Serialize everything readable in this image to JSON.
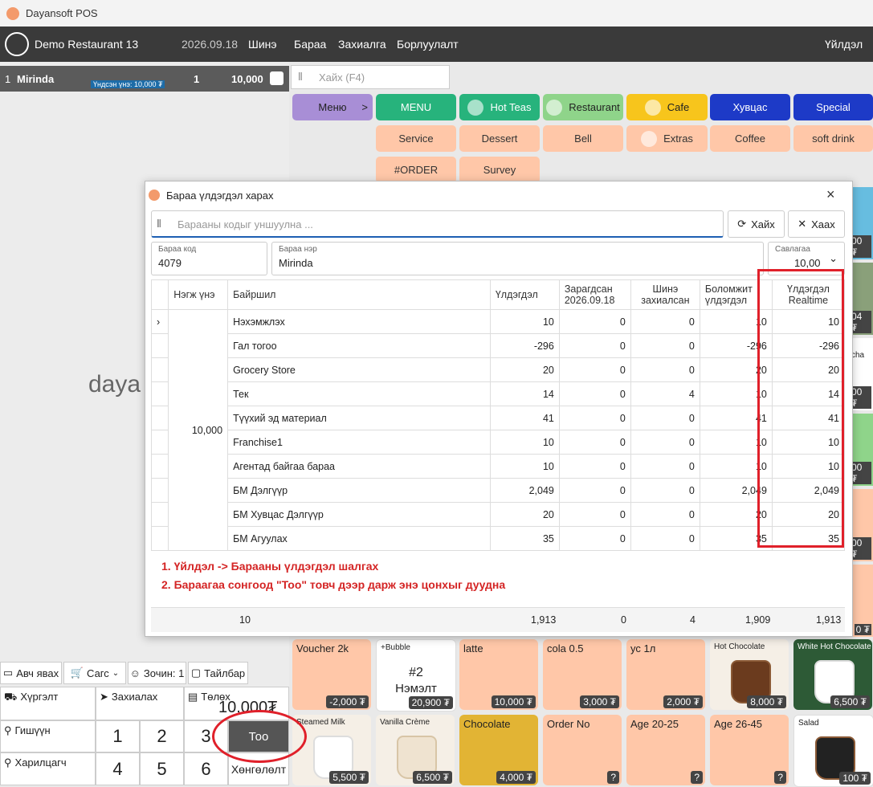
{
  "app": {
    "title": "Dayansoft POS"
  },
  "topbar": {
    "restaurant": "Demo Restaurant 13",
    "date": "2026.09.18",
    "menu": [
      "Шинэ",
      "Бараа",
      "Захиалга",
      "Борлуулалт"
    ],
    "right": "Үйлдэл"
  },
  "order": {
    "line": "1",
    "item": "Mirinda",
    "base_price": "Үндсэн үнэ: 10,000 ₮",
    "qty": "1",
    "total": "10,000"
  },
  "search": {
    "placeholder": "Хайх (F4)"
  },
  "categories": {
    "row1": [
      "Меню",
      ">",
      "MENU",
      "Hot Teas",
      "Restaurant",
      "Cafe",
      "Хувцас",
      "Special"
    ],
    "row2": [
      "Service",
      "Dessert",
      "Bell",
      "Extras",
      "Coffee",
      "soft drink"
    ],
    "row3": [
      "#ORDER",
      "Survey"
    ]
  },
  "bg_logo": "daya",
  "tiles": {
    "row1": [
      {
        "name": "Voucher 2k",
        "price": "-2,000 ₮"
      },
      {
        "name": "+Bubble",
        "center1": "#2",
        "center2": "Нэмэлт",
        "price": "20,900 ₮"
      },
      {
        "name": "latte",
        "price": "10,000 ₮"
      },
      {
        "name": "cola 0.5",
        "price": "3,000 ₮"
      },
      {
        "name": "ус 1л",
        "price": "2,000 ₮"
      },
      {
        "name": "Hot Chocolate",
        "price": "8,000 ₮"
      },
      {
        "name": "White Hot Chocolate",
        "price": "6,500 ₮"
      }
    ],
    "row2": [
      {
        "name": "Steamed Milk",
        "price": "5,500 ₮"
      },
      {
        "name": "Vanilla Crème",
        "price": "6,500 ₮"
      },
      {
        "name": "Chocolate",
        "price": "4,000 ₮"
      },
      {
        "name": "Order No",
        "price": "?"
      },
      {
        "name": "Age 20-25",
        "price": "?"
      },
      {
        "name": "Age 26-45",
        "price": "?"
      },
      {
        "name": "Salad",
        "price": "100 ₮"
      }
    ],
    "edge": [
      "00 ₮",
      "04 ₮",
      "cha",
      "00 ₮",
      "00 ₮",
      "00 ₮",
      "0 ₮"
    ]
  },
  "actions": {
    "take_away": "Авч явах",
    "basket": "Сагс",
    "guest": "Зочин: 1",
    "note": "Тайлбар"
  },
  "bottom": {
    "delivery": "Хүргэлт",
    "order": "Захиалах",
    "pay": "Төлөх",
    "member": "Гишүүн",
    "customer": "Харилцагч",
    "amount": "10,000₮",
    "qty_btn": "Тоо",
    "discount": "Хөнгөлөлт",
    "keys": [
      "1",
      "2",
      "3",
      "4",
      "5",
      "6"
    ]
  },
  "dialog": {
    "title": "Бараа үлдэгдэл харах",
    "barcode_placeholder": "Барааны кодыг уншуулна ...",
    "search_btn": "Хайх",
    "close_btn": "Хаах",
    "code_label": "Бараа код",
    "code_value": "4079",
    "name_label": "Бараа нэр",
    "name_value": "Mirinda",
    "pack_label": "Савлагаа",
    "pack_value": "10,00",
    "headers": [
      "Нэгж үнэ",
      "Байршил",
      "Үлдэгдэл",
      "Зарагдсан 2026.09.18",
      "Шинэ захиалсан",
      "Боломжит үлдэгдэл",
      "Үлдэгдэл Realtime"
    ],
    "unit_price": "10,000",
    "rows": [
      [
        "Нэхэмжлэх",
        "10",
        "0",
        "0",
        "10",
        "10"
      ],
      [
        "Гал тогоо",
        "-296",
        "0",
        "0",
        "-296",
        "-296"
      ],
      [
        "Grocery Store",
        "20",
        "0",
        "0",
        "20",
        "20"
      ],
      [
        "Тек",
        "14",
        "0",
        "4",
        "10",
        "14"
      ],
      [
        "Түүхий эд материал",
        "41",
        "0",
        "0",
        "41",
        "41"
      ],
      [
        "Franchise1",
        "10",
        "0",
        "0",
        "10",
        "10"
      ],
      [
        "Агентад байгаа бараа",
        "10",
        "0",
        "0",
        "10",
        "10"
      ],
      [
        "БМ Дэлгүүр",
        "2,049",
        "0",
        "0",
        "2,049",
        "2,049"
      ],
      [
        "БМ Хувцас Дэлгүүр",
        "20",
        "0",
        "0",
        "20",
        "20"
      ],
      [
        "БМ Агуулах",
        "35",
        "0",
        "0",
        "35",
        "35"
      ]
    ],
    "note1": "1. Үйлдэл -> Барааны үлдэгдэл шалгах",
    "note2": "2. Бараагаа сонгоод \"Тоо\" товч дээр дарж энэ цонхыг дуудна",
    "footer": {
      "count": "10",
      "stock": "1,913",
      "sold": "0",
      "new": "4",
      "avail": "1,909",
      "realtime": "1,913"
    }
  }
}
